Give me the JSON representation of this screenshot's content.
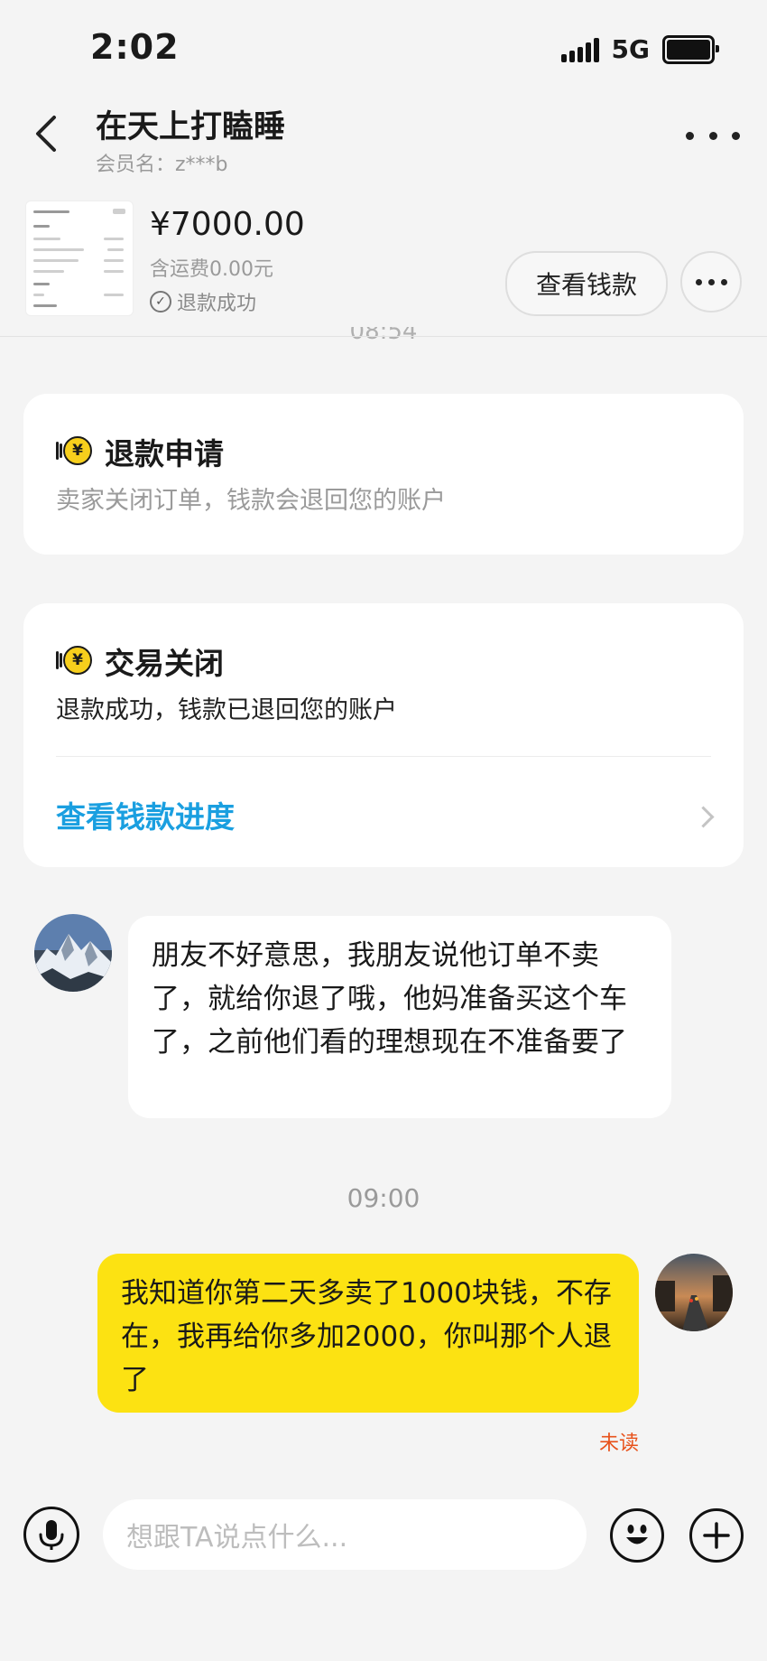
{
  "status_bar": {
    "time": "2:02",
    "network": "5G"
  },
  "header": {
    "title": "在天上打瞌睡",
    "member_label": "会员名：z***b"
  },
  "order": {
    "price": "¥7000.00",
    "shipping": "含运费0.00元",
    "status": "退款成功",
    "view_button": "查看钱款"
  },
  "chat": {
    "cut_off_time": "08:54",
    "card_refund": {
      "title": "退款申请",
      "subtitle": "卖家关闭订单，钱款会退回您的账户"
    },
    "card_closed": {
      "title": "交易关闭",
      "subtitle": "退款成功，钱款已退回您的账户",
      "link": "查看钱款进度"
    },
    "incoming_message": "朋友不好意思，我朋友说他订单不卖了，就给你退了哦，他妈准备买这个车了，之前他们看的理想现在不准备要了",
    "time_divider": "09:00",
    "outgoing_message": "我知道你第二天多卖了1000块钱，不存在，我再给你多加2000，你叫那个人退了",
    "outgoing_status": "未读"
  },
  "input_bar": {
    "placeholder": "想跟TA说点什么..."
  },
  "colors": {
    "accent_yellow": "#fce212",
    "link_blue": "#1a9fe0",
    "unread_red": "#e8531c",
    "coin_yellow": "#f7cf1c"
  },
  "icons": [
    "back-icon",
    "more-icon",
    "check-circle-icon",
    "coin-icon",
    "chevron-right-icon",
    "microphone-icon",
    "emoji-icon",
    "plus-icon"
  ]
}
